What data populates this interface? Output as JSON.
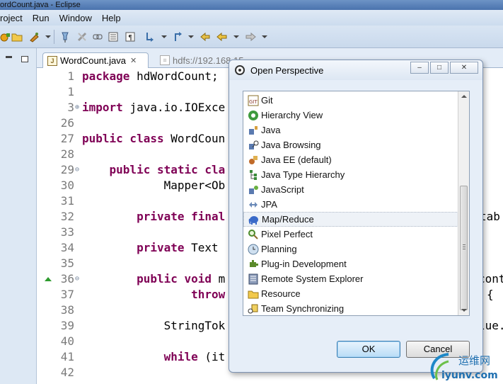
{
  "window": {
    "title": "ordCount.java - Eclipse"
  },
  "menu": [
    "roject",
    "Run",
    "Window",
    "Help"
  ],
  "editor": {
    "tabs": [
      {
        "label": "WordCount.java",
        "active": true
      },
      {
        "label": "hdfs://192.168.15",
        "active": false
      }
    ],
    "lines": [
      {
        "num": "1",
        "parts": [
          {
            "t": "package ",
            "k": true
          },
          {
            "t": "hdWordCount;",
            "k": false
          }
        ]
      },
      {
        "num": "1",
        "parts": []
      },
      {
        "num": "3",
        "fold": "plus",
        "parts": [
          {
            "t": "import ",
            "k": true
          },
          {
            "t": "java.io.IOExce",
            "k": false
          }
        ]
      },
      {
        "num": "26",
        "parts": []
      },
      {
        "num": "27",
        "parts": [
          {
            "t": "public class ",
            "k": true
          },
          {
            "t": "WordCoun",
            "k": false
          }
        ]
      },
      {
        "num": "28",
        "parts": []
      },
      {
        "num": "29",
        "fold": "minus",
        "parts": [
          {
            "t": "    public static ",
            "k": true
          },
          {
            "t": "cla",
            "k": true
          }
        ]
      },
      {
        "num": "30",
        "parts": [
          {
            "t": "            Mapper<Ob",
            "k": false
          }
        ]
      },
      {
        "num": "31",
        "parts": []
      },
      {
        "num": "32",
        "parts": [
          {
            "t": "        private final",
            "k": true
          }
        ]
      },
      {
        "num": "33",
        "parts": []
      },
      {
        "num": "34",
        "parts": [
          {
            "t": "        private ",
            "k": true
          },
          {
            "t": "Text",
            "k": false
          }
        ]
      },
      {
        "num": "35",
        "parts": []
      },
      {
        "num": "36",
        "fold": "minus",
        "marker": true,
        "parts": [
          {
            "t": "        public void ",
            "k": true
          },
          {
            "t": "m",
            "k": false
          }
        ]
      },
      {
        "num": "37",
        "parts": [
          {
            "t": "                throw",
            "k": true
          }
        ]
      },
      {
        "num": "38",
        "parts": []
      },
      {
        "num": "39",
        "parts": [
          {
            "t": "            StringTok",
            "k": false
          }
        ]
      },
      {
        "num": "40",
        "parts": []
      },
      {
        "num": "41",
        "parts": [
          {
            "t": "            while ",
            "k": true
          },
          {
            "t": "(it",
            "k": false
          }
        ]
      },
      {
        "num": "42",
        "parts": []
      }
    ],
    "right_fragments": [
      {
        "text": "tab"
      },
      {
        "text": "cont"
      },
      {
        "text": "{"
      },
      {
        "text": "lue."
      }
    ]
  },
  "dialog": {
    "title": "Open Perspective",
    "controls": {
      "minimize": "–",
      "maximize": "□",
      "close": "✕"
    },
    "items": [
      {
        "label": "Git",
        "icon": "git-icon"
      },
      {
        "label": "Hierarchy View",
        "icon": "hierarchy-view-icon"
      },
      {
        "label": "Java",
        "icon": "java-perspective-icon"
      },
      {
        "label": "Java Browsing",
        "icon": "java-browsing-icon"
      },
      {
        "label": "Java EE (default)",
        "icon": "java-ee-icon"
      },
      {
        "label": "Java Type Hierarchy",
        "icon": "type-hierarchy-icon"
      },
      {
        "label": "JavaScript",
        "icon": "javascript-icon"
      },
      {
        "label": "JPA",
        "icon": "jpa-icon"
      },
      {
        "label": "Map/Reduce",
        "icon": "elephant-icon",
        "selected": true
      },
      {
        "label": "Pixel Perfect",
        "icon": "magnifier-icon"
      },
      {
        "label": "Planning",
        "icon": "planning-icon"
      },
      {
        "label": "Plug-in Development",
        "icon": "plugin-icon"
      },
      {
        "label": "Remote System Explorer",
        "icon": "remote-system-icon"
      },
      {
        "label": "Resource",
        "icon": "folder-icon"
      },
      {
        "label": "Team Synchronizing",
        "icon": "team-sync-icon"
      }
    ],
    "ok_label": "OK",
    "cancel_label": "Cancel"
  },
  "watermark": {
    "top": "运维网",
    "bottom": "iyunv.com"
  },
  "colors": {
    "keyword": "#7f0055",
    "line_number": "#7a7a7a",
    "dialog_bg": "#e6eef8",
    "ok_border": "#3c7fb1"
  }
}
